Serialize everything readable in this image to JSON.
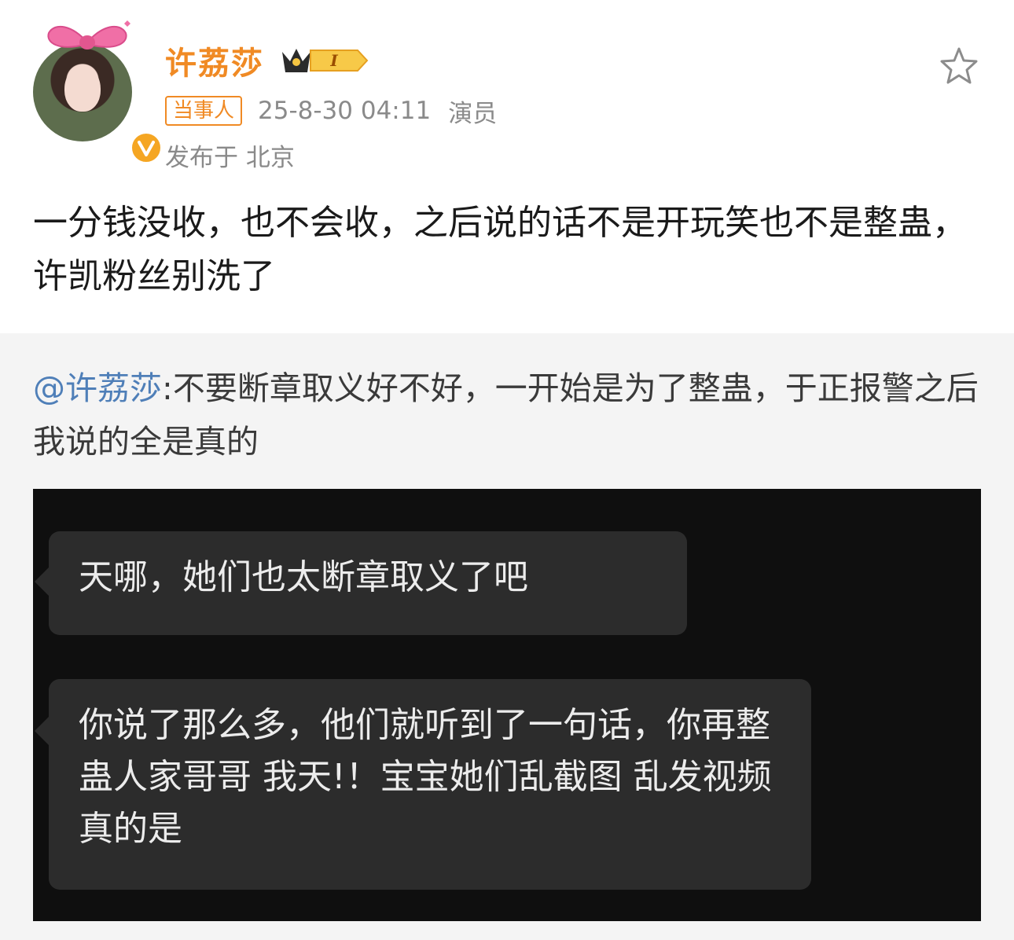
{
  "post": {
    "username": "许荔莎",
    "vip_level": "I",
    "role_tag": "当事人",
    "date": "25-8-30 04:11",
    "title": "演员",
    "location": "发布于 北京",
    "text": "一分钱没收，也不会收，之后说的话不是开玩笑也不是整蛊，许凯粉丝别洗了"
  },
  "quoted": {
    "mention": "@许荔莎",
    "text": ":不要断章取义好不好，一开始是为了整蛊，于正报警之后我说的全是真的"
  },
  "chat": {
    "messages": [
      "天哪，她们也太断章取义了吧",
      "你说了那么多，他们就听到了一句话，你再整蛊人家哥哥 我天!！宝宝她们乱截图 乱发视频真的是"
    ]
  },
  "colors": {
    "accent": "#f08a24",
    "mention": "#4f7fb8",
    "quote_bg": "#f4f4f4",
    "media_bg": "#0f0f0f",
    "bubble_bg": "#2c2c2c"
  },
  "icons": [
    "bow-icon",
    "verified-icon",
    "vip-crown-icon",
    "star-icon"
  ]
}
